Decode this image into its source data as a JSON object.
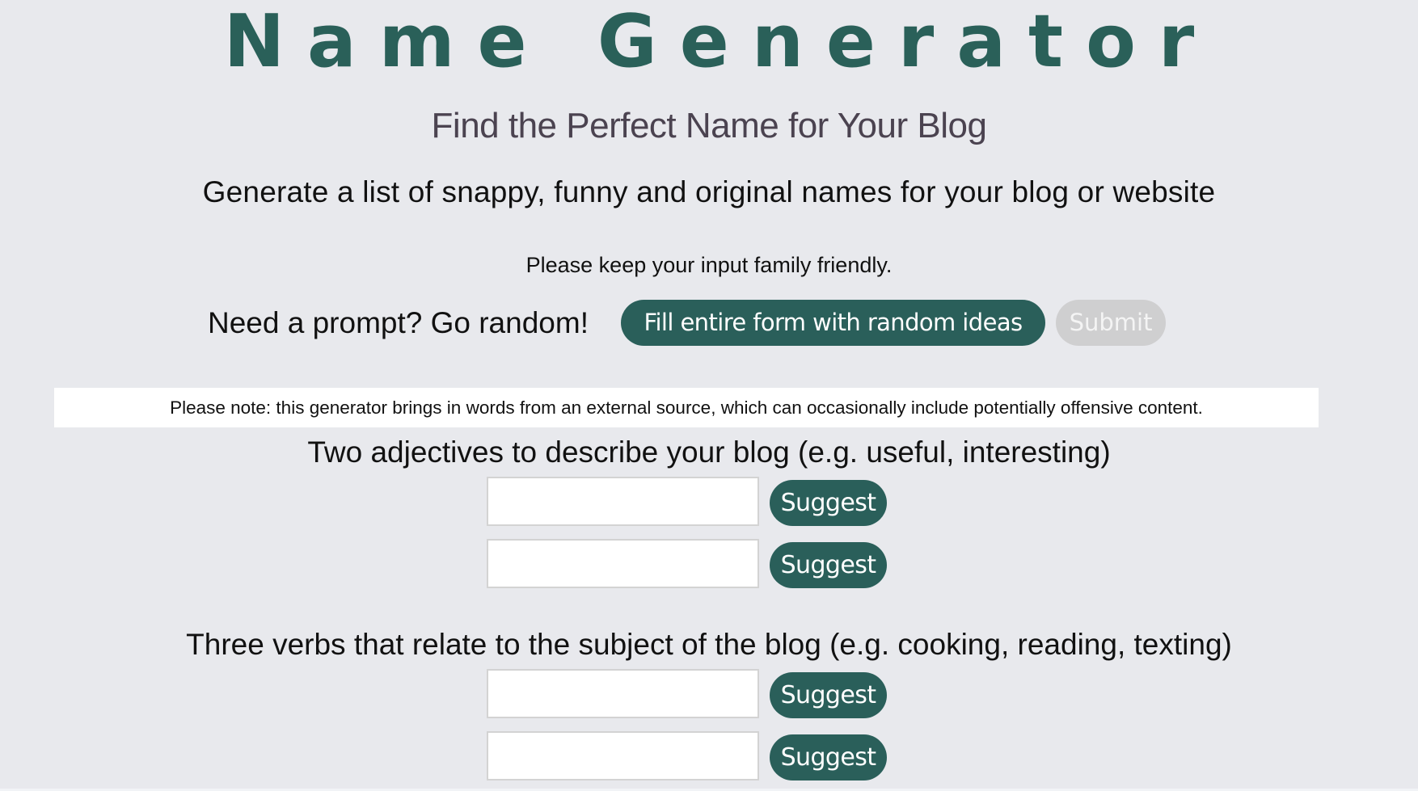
{
  "header": {
    "title": "Name Generator",
    "subtitle": "Find the Perfect Name for Your Blog",
    "description": "Generate a list of snappy, funny and original names for your blog or website",
    "family_note": "Please keep your input family friendly."
  },
  "prompt_row": {
    "prompt_text": "Need a prompt? Go random!",
    "fill_button_label": "Fill entire form with random ideas",
    "submit_button_label": "Submit"
  },
  "notice": {
    "text": "Please note: this generator brings in words from an external source, which can occasionally include potentially offensive content."
  },
  "form": {
    "adjectives": {
      "label": "Two adjectives to describe your blog (e.g. useful, interesting)",
      "fields": [
        {
          "value": "",
          "placeholder": "",
          "suggest_label": "Suggest"
        },
        {
          "value": "",
          "placeholder": "",
          "suggest_label": "Suggest"
        }
      ]
    },
    "verbs": {
      "label": "Three verbs that relate to the subject of the blog (e.g. cooking, reading, texting)",
      "fields": [
        {
          "value": "",
          "placeholder": "",
          "suggest_label": "Suggest"
        },
        {
          "value": "",
          "placeholder": "",
          "suggest_label": "Suggest"
        }
      ]
    }
  },
  "colors": {
    "accent": "#2a5f5a",
    "title": "#2a6059",
    "subtitle": "#4b4350",
    "background": "#e8e9ed",
    "submit_disabled": "#cfcfd0"
  }
}
